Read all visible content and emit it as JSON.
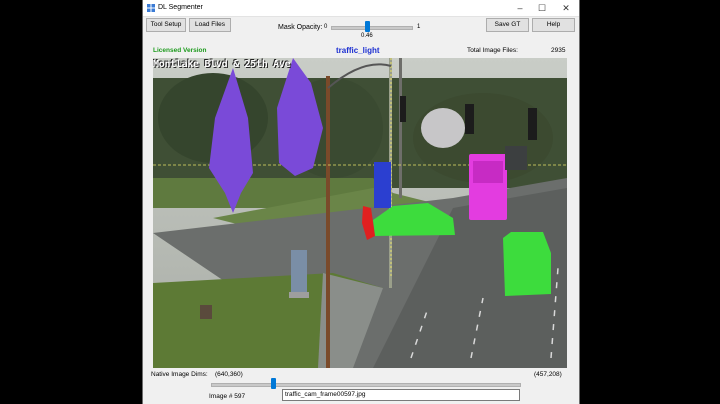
{
  "window": {
    "title": "DL Segmenter",
    "controls": {
      "minimize": "–",
      "maximize": "☐",
      "close": "✕"
    }
  },
  "toolbar": {
    "tool_setup": "Tool Setup",
    "load_files": "Load Files",
    "save_gt": "Save GT",
    "help": "Help"
  },
  "mask_opacity": {
    "label": "Mask Opacity:",
    "min": "0",
    "max": "1",
    "value": "0.46"
  },
  "status": {
    "license": "Licensed Version",
    "selected_class": "traffic_light",
    "total_label": "Total Image Files:",
    "total_value": "2935"
  },
  "image": {
    "overlay_text": "Montlake Blvd & 25th Ave"
  },
  "footer": {
    "dims_label": "Native Image Dims:",
    "dims_value": "(640,360)",
    "cursor_value": "(457,208)",
    "image_label": "Image # 597",
    "filename": "traffic_cam_frame00597.jpg",
    "frame_index": 597,
    "frame_total": 2935
  },
  "colors": {
    "tree_mask": "#7a4ad8",
    "vehicle_mask": "#3ddc3d",
    "truck_mask": "#e33ce0",
    "traffic_light_mask": "#2b3fd0",
    "person_mask": "#e02020",
    "license_text": "#1c9a1c",
    "class_text": "#1c2fd1",
    "slider_thumb": "#0078d7"
  }
}
